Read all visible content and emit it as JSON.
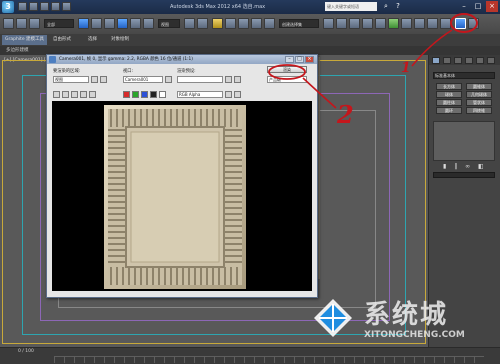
{
  "app": {
    "title": "Autodesk 3ds Max 2012 x64    选自.max",
    "search_placeholder": "键入关键字或短语",
    "logo_glyph": "3"
  },
  "toolbar": {
    "selection_filter": "全部",
    "view_dropdown": "视图",
    "named_sel_dropdown": "创建选择集"
  },
  "ribbon": {
    "tabs": [
      "Graphite 建模工具",
      "自由形式",
      "选择",
      "对象绘制"
    ],
    "sub_label": "多边形建模"
  },
  "viewport": {
    "label": "[+] [Camera001] [真实]"
  },
  "dialog": {
    "title": "Camera001, 帧 0, 显示 gamma: 2.2, RGBA 颜色 16 位/通道 (1:1)",
    "area_label": "要渲染的区域:",
    "area_value": "视图",
    "viewport_label": "视口:",
    "viewport_value": "Camera001",
    "preset_label": "渲染预设:",
    "preset_value": "",
    "render_button": "渲染",
    "render_sub": "产品级",
    "channel_value": "RGB Alpha",
    "swatch_colors": [
      "#d62b2b",
      "#2aa52a",
      "#2b4fd6",
      "#222222",
      "#ffffff"
    ]
  },
  "command_panel": {
    "dropdown": "标准基本体",
    "buttons": [
      "长方体",
      "圆锥体",
      "球体",
      "几何球体",
      "圆柱体",
      "管状体",
      "圆环",
      "四棱锥",
      "茶壶",
      "平面"
    ],
    "section_name": "名称和颜色"
  },
  "statusbar": {
    "frame_counter": "0 / 100"
  },
  "annotations": {
    "one": "1",
    "two": "2"
  },
  "watermark": {
    "brand_cn": "系统城",
    "brand_en": "XITONGCHENG.COM"
  }
}
